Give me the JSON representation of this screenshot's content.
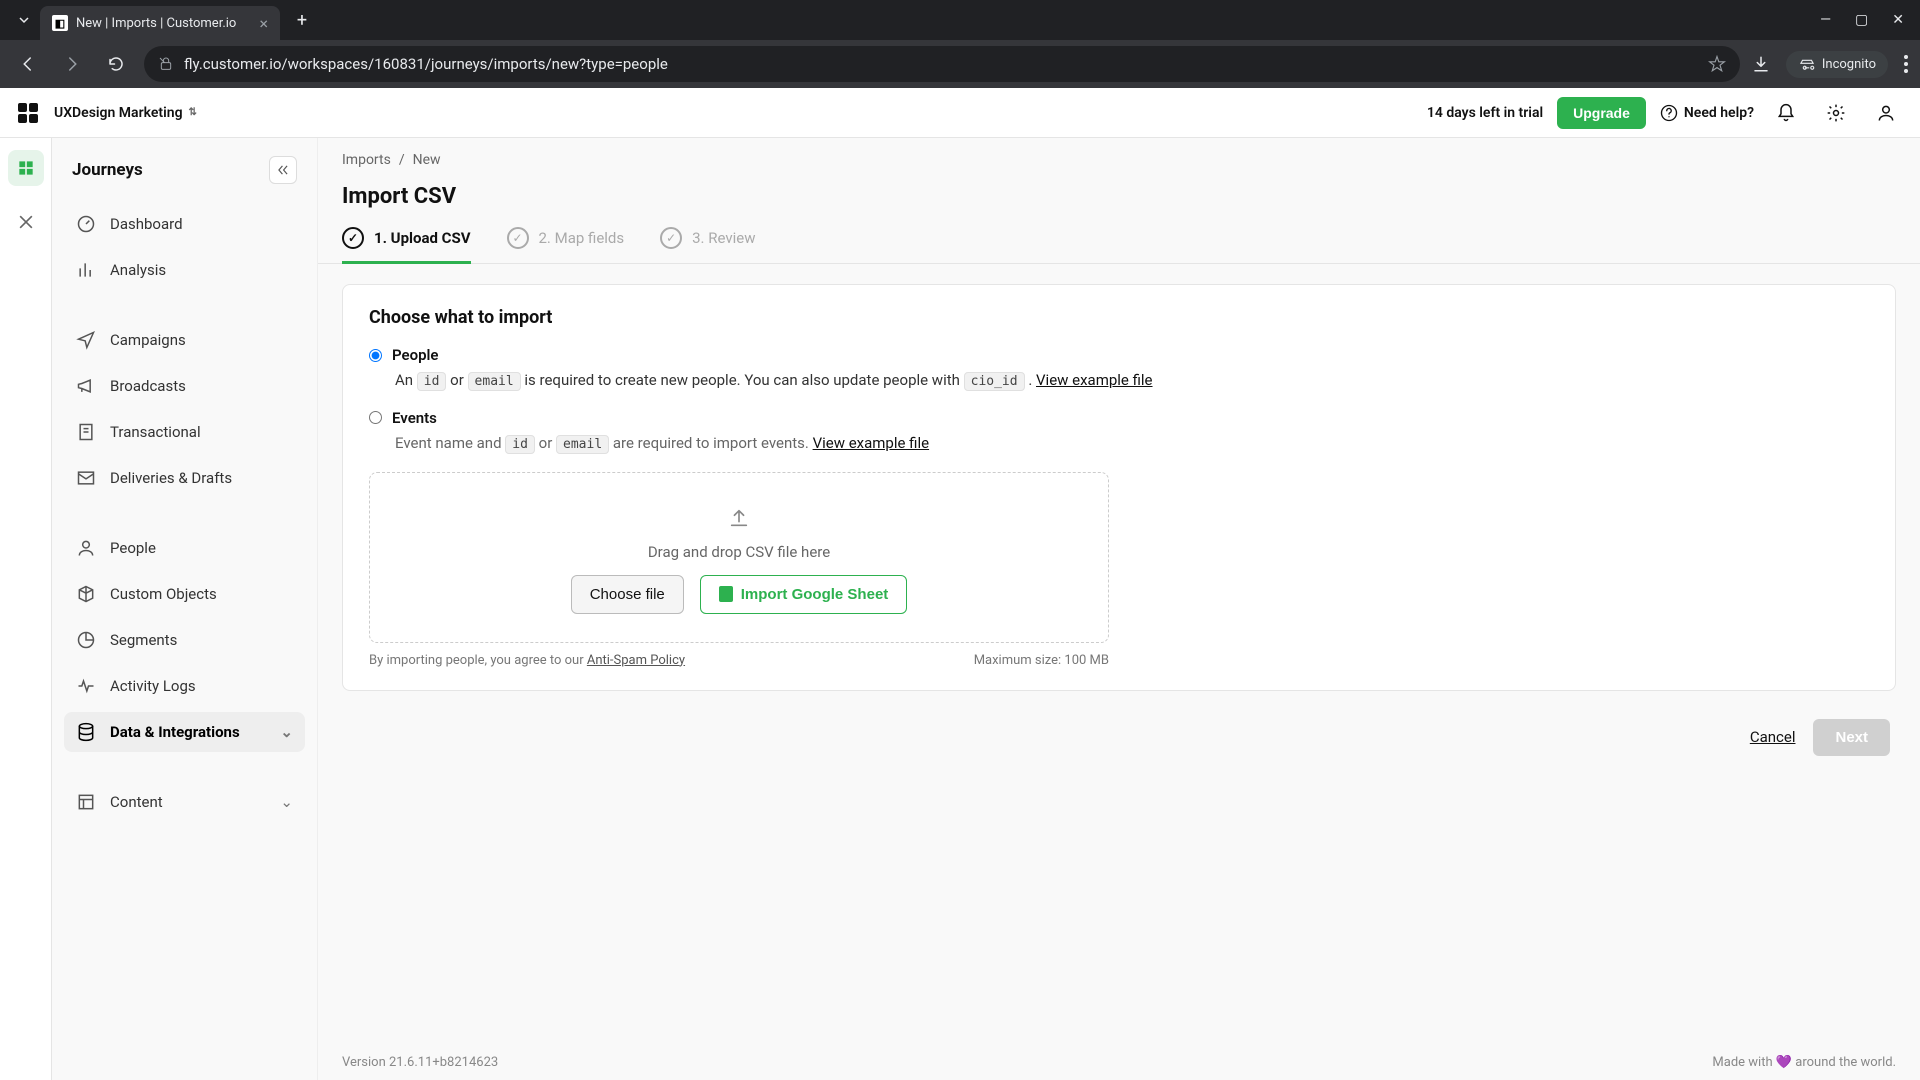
{
  "browser": {
    "tab_title": "New | Imports | Customer.io",
    "url": "fly.customer.io/workspaces/160831/journeys/imports/new?type=people",
    "incognito_label": "Incognito"
  },
  "header": {
    "workspace": "UXDesign Marketing",
    "trial_text": "14 days left in trial",
    "upgrade": "Upgrade",
    "help": "Need help?"
  },
  "sidebar": {
    "title": "Journeys",
    "items": {
      "dashboard": "Dashboard",
      "analysis": "Analysis",
      "campaigns": "Campaigns",
      "broadcasts": "Broadcasts",
      "transactional": "Transactional",
      "deliveries": "Deliveries & Drafts",
      "people": "People",
      "customobjects": "Custom Objects",
      "segments": "Segments",
      "activitylogs": "Activity Logs",
      "dataintegrations": "Data & Integrations",
      "content": "Content"
    }
  },
  "breadcrumbs": {
    "parent": "Imports",
    "sep": "/",
    "current": "New"
  },
  "page": {
    "title": "Import CSV"
  },
  "steps": {
    "s1": "1. Upload CSV",
    "s2": "2. Map fields",
    "s3": "3. Review"
  },
  "panel": {
    "heading": "Choose what to import",
    "people_label": "People",
    "people_desc_pre": "An ",
    "people_code1": "id",
    "people_or": " or ",
    "people_code2": "email",
    "people_desc_mid": " is required to create new people. You can also update people with ",
    "people_code3": "cio_id",
    "people_desc_post": " . ",
    "people_example": "View example file",
    "events_label": "Events",
    "events_desc_pre": "Event name and ",
    "events_code1": "id",
    "events_or": " or ",
    "events_code2": "email",
    "events_desc_post": " are required to import events. ",
    "events_example": "View example file"
  },
  "dropzone": {
    "text": "Drag and drop CSV file here",
    "choose_file": "Choose file",
    "google_sheet": "Import Google Sheet",
    "policy_pre": "By importing people, you agree to our ",
    "policy_link": "Anti-Spam Policy",
    "max_size": "Maximum size: 100 MB"
  },
  "actions": {
    "cancel": "Cancel",
    "next": "Next"
  },
  "footer": {
    "version": "Version 21.6.11+b8214623",
    "made_pre": "Made with ",
    "made_post": " around the world."
  }
}
